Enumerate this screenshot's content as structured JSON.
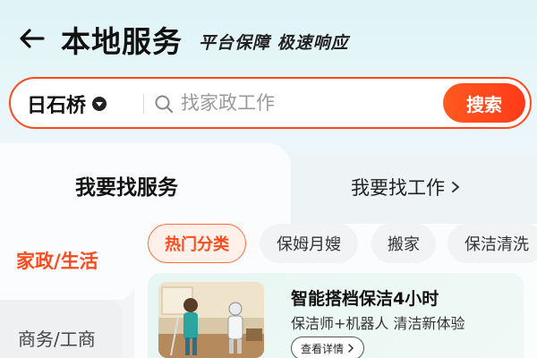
{
  "header": {
    "title": "本地服务",
    "slogan": "平台保障 极速响应",
    "back_icon": "arrow-left-icon"
  },
  "search": {
    "location": "日石桥",
    "location_icon": "map-pin-icon",
    "placeholder": "找家政工作",
    "value": "",
    "button_label": "搜索",
    "accent_color": "#ff4a1c"
  },
  "tabs": [
    {
      "label": "我要找服务",
      "active": true
    },
    {
      "label": "我要找工作",
      "active": false
    }
  ],
  "sidebar": {
    "items": [
      {
        "label": "家政/生活",
        "active": true
      },
      {
        "label": "商务/工商",
        "active": false
      }
    ]
  },
  "chips": [
    {
      "label": "热门分类",
      "active": true
    },
    {
      "label": "保姆月嫂",
      "active": false
    },
    {
      "label": "搬家",
      "active": false
    },
    {
      "label": "保洁清洗",
      "active": false
    }
  ],
  "promo": {
    "title": "智能搭档保洁4小时",
    "subtitle": "保洁师+机器人 清洁新体验",
    "button_label": "查看详情"
  }
}
